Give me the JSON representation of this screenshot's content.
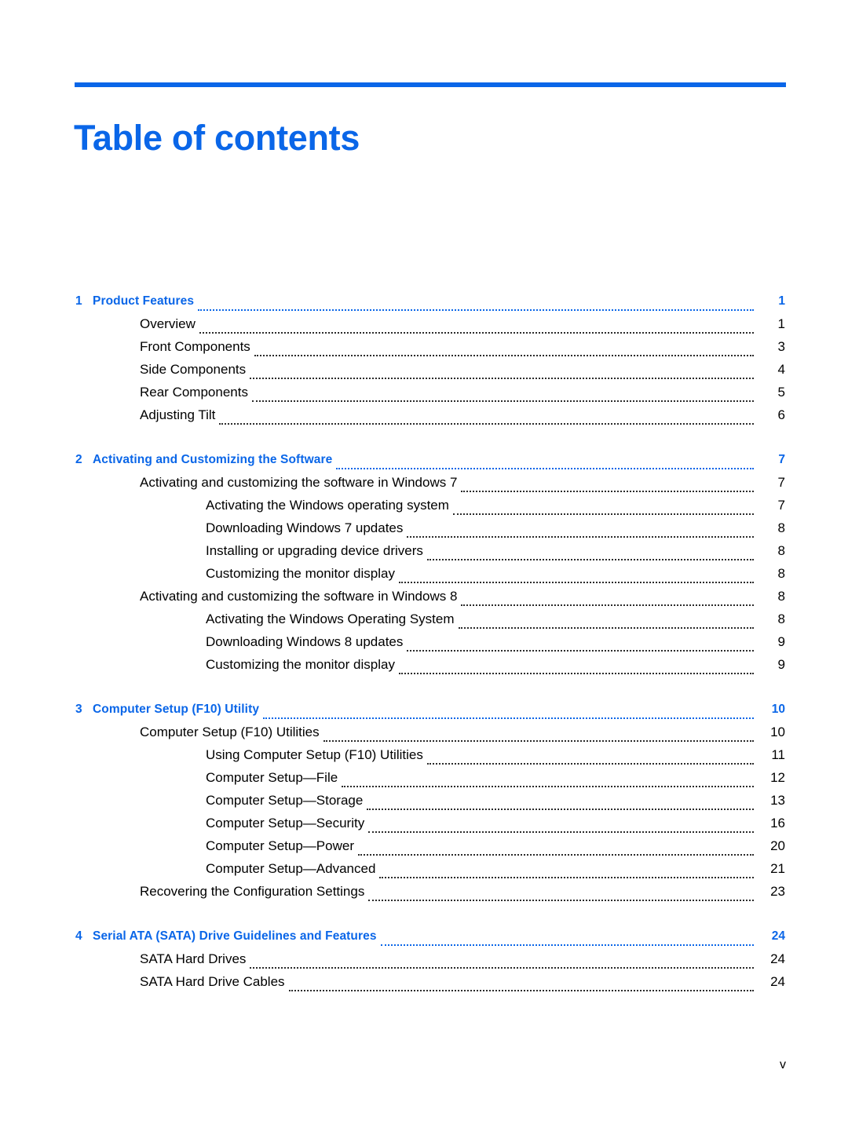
{
  "document": {
    "title": "Table of contents",
    "accent_color": "#0A66E8",
    "folio": "v"
  },
  "toc": {
    "entries": [
      {
        "level": "chapter",
        "number": "1",
        "label": "Product Features",
        "page": "1"
      },
      {
        "level": "1",
        "label": "Overview",
        "page": "1"
      },
      {
        "level": "1",
        "label": "Front Components",
        "page": "3"
      },
      {
        "level": "1",
        "label": "Side Components",
        "page": "4"
      },
      {
        "level": "1",
        "label": "Rear Components",
        "page": "5"
      },
      {
        "level": "1",
        "label": "Adjusting Tilt",
        "page": "6"
      },
      {
        "level": "chapter",
        "number": "2",
        "label": "Activating and Customizing the Software",
        "page": "7"
      },
      {
        "level": "1",
        "label": "Activating and customizing the software in Windows 7",
        "page": "7"
      },
      {
        "level": "2",
        "label": "Activating the Windows operating system",
        "page": "7"
      },
      {
        "level": "2",
        "label": "Downloading Windows 7 updates",
        "page": "8"
      },
      {
        "level": "2",
        "label": "Installing or upgrading device drivers",
        "page": "8"
      },
      {
        "level": "2",
        "label": "Customizing the monitor display",
        "page": "8"
      },
      {
        "level": "1",
        "label": "Activating and customizing the software in Windows 8",
        "page": "8"
      },
      {
        "level": "2",
        "label": "Activating the Windows Operating System",
        "page": "8"
      },
      {
        "level": "2",
        "label": "Downloading Windows 8 updates",
        "page": "9"
      },
      {
        "level": "2",
        "label": "Customizing the monitor display",
        "page": "9"
      },
      {
        "level": "chapter",
        "number": "3",
        "label": "Computer Setup (F10) Utility",
        "page": "10"
      },
      {
        "level": "1",
        "label": "Computer Setup (F10) Utilities",
        "page": "10"
      },
      {
        "level": "2",
        "label": "Using Computer Setup (F10) Utilities",
        "page": "11"
      },
      {
        "level": "2",
        "label": "Computer Setup—File",
        "page": "12"
      },
      {
        "level": "2",
        "label": "Computer Setup—Storage",
        "page": "13"
      },
      {
        "level": "2",
        "label": "Computer Setup—Security",
        "page": "16"
      },
      {
        "level": "2",
        "label": "Computer Setup—Power",
        "page": "20"
      },
      {
        "level": "2",
        "label": "Computer Setup—Advanced",
        "page": "21"
      },
      {
        "level": "1",
        "label": "Recovering the Configuration Settings",
        "page": "23"
      },
      {
        "level": "chapter",
        "number": "4",
        "label": "Serial ATA (SATA) Drive Guidelines and Features",
        "page": "24"
      },
      {
        "level": "1",
        "label": "SATA Hard Drives",
        "page": "24"
      },
      {
        "level": "1",
        "label": "SATA Hard Drive Cables",
        "page": "24"
      }
    ]
  }
}
